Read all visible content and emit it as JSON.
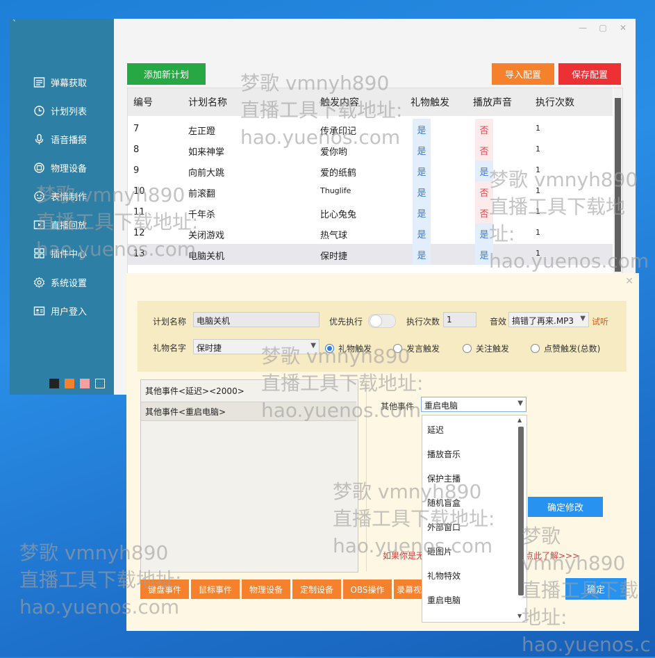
{
  "window": {
    "top_glyph": "`",
    "minimize_glyph": "—",
    "maximize_glyph": "▢",
    "close_glyph": "✕"
  },
  "sidebar": {
    "items": [
      {
        "label": "弹幕获取",
        "icon": "list-icon"
      },
      {
        "label": "计划列表",
        "icon": "plan-icon"
      },
      {
        "label": "语音播报",
        "icon": "microphone-icon"
      },
      {
        "label": "物理设备",
        "icon": "device-icon"
      },
      {
        "label": "表情制作",
        "icon": "emoji-icon"
      },
      {
        "label": "直播回放",
        "icon": "replay-icon"
      },
      {
        "label": "插件中心",
        "icon": "plugin-icon"
      },
      {
        "label": "系统设置",
        "icon": "gear-icon"
      },
      {
        "label": "用户登入",
        "icon": "user-card-icon"
      }
    ],
    "swatches": [
      "#222222",
      "#f5812c",
      "#f4a0a0",
      "#2d7fa6"
    ]
  },
  "toolbar": {
    "add_label": "添加新计划",
    "import_label": "导入配置",
    "save_label": "保存配置"
  },
  "table": {
    "headers": [
      "编号",
      "计划名称",
      "触发内容",
      "礼物触发",
      "播放声音",
      "执行次数"
    ],
    "rows": [
      {
        "id": "7",
        "name": "左正蹬",
        "content": "传承印记",
        "gift": "是",
        "sound": "否",
        "count": "1"
      },
      {
        "id": "8",
        "name": "如来神掌",
        "content": "爱你哟",
        "gift": "是",
        "sound": "否",
        "count": "1"
      },
      {
        "id": "9",
        "name": "向前大跳",
        "content": "爱的纸鹤",
        "gift": "是",
        "sound": "是",
        "count": "1"
      },
      {
        "id": "10",
        "name": "前滚翻",
        "content": "Thuglife",
        "gift": "是",
        "sound": "否",
        "count": "1"
      },
      {
        "id": "11",
        "name": "千年杀",
        "content": "比心兔兔",
        "gift": "是",
        "sound": "否",
        "count": "1"
      },
      {
        "id": "12",
        "name": "关闭游戏",
        "content": "热气球",
        "gift": "是",
        "sound": "是",
        "count": "1"
      },
      {
        "id": "13",
        "name": "电脑关机",
        "content": "保时捷",
        "gift": "是",
        "sound": "是",
        "count": "1"
      }
    ]
  },
  "dialog": {
    "close_glyph": "✕",
    "plan_name_label": "计划名称",
    "plan_name_value": "电脑关机",
    "priority_label": "优先执行",
    "exec_count_label": "执行次数",
    "exec_count_value": "1",
    "sound_label": "音效",
    "sound_value": "搞错了再来.MP3",
    "try_label": "试听",
    "gift_name_label": "礼物名字",
    "gift_name_value": "保时捷",
    "triggers": [
      "礼物触发",
      "发言触发",
      "关注触发",
      "点赞触发(总数)"
    ],
    "events": [
      "其他事件<延迟><2000>",
      "其他事件<重启电脑>"
    ],
    "other_event_label": "其他事件",
    "other_event_value": "重启电脑",
    "dropdown_options": [
      "延迟",
      "播放音乐",
      "保护主播",
      "随机盲盒",
      "外部窗口",
      "砸图片",
      "礼物特效",
      "重启电脑"
    ],
    "confirm_edit_label": "确定修改",
    "hint_text": "如果你是无",
    "learn_more_label": "点此了解>>>",
    "confirm_label": "确定",
    "tabs": [
      "键盘事件",
      "鼠标事件",
      "物理设备",
      "定制设备",
      "OBS操作",
      "录幕视"
    ]
  },
  "watermark": {
    "line1": "梦歌 vmnyh890",
    "line2": "直播工具下载地址:",
    "line3": "hao.yuenos.com",
    "line2_wrap_a": "直播工具下载地",
    "line2_wrap_b": "址:",
    "cut_tail": "hao.yuenos.c",
    "cut_a": "梦歌",
    "cut_b": "vmnyh890",
    "cut_c": "直播工具下载",
    "cut_d": "地址:"
  }
}
